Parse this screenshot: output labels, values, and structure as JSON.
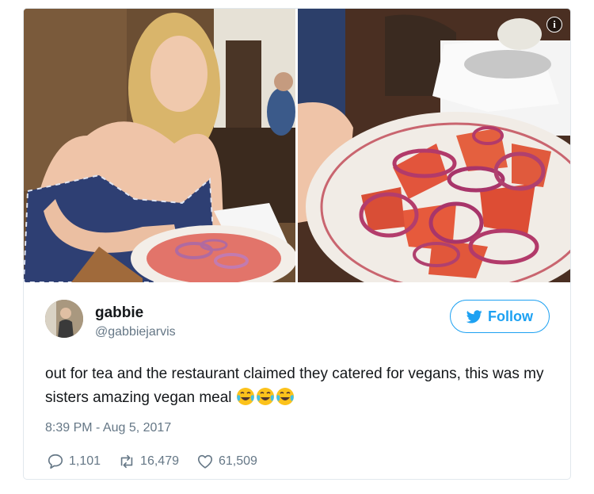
{
  "tweet": {
    "display_name": "gabbie",
    "handle": "@gabbiejarvis",
    "text": "out for tea and the restaurant claimed they catered for vegans, this was my sisters amazing vegan meal",
    "emoji": [
      "face-with-tears-of-joy",
      "face-with-tears-of-joy",
      "face-with-tears-of-joy"
    ],
    "timestamp": "8:39 PM - Aug 5, 2017",
    "follow_label": "Follow"
  },
  "stats": {
    "replies": "1,101",
    "retweets": "16,479",
    "likes": "61,509"
  },
  "media": {
    "photo_count": 2,
    "info_badge": "i"
  },
  "colors": {
    "accent": "#1da1f2",
    "secondary_text": "#657786",
    "border": "#e1e8ed"
  }
}
